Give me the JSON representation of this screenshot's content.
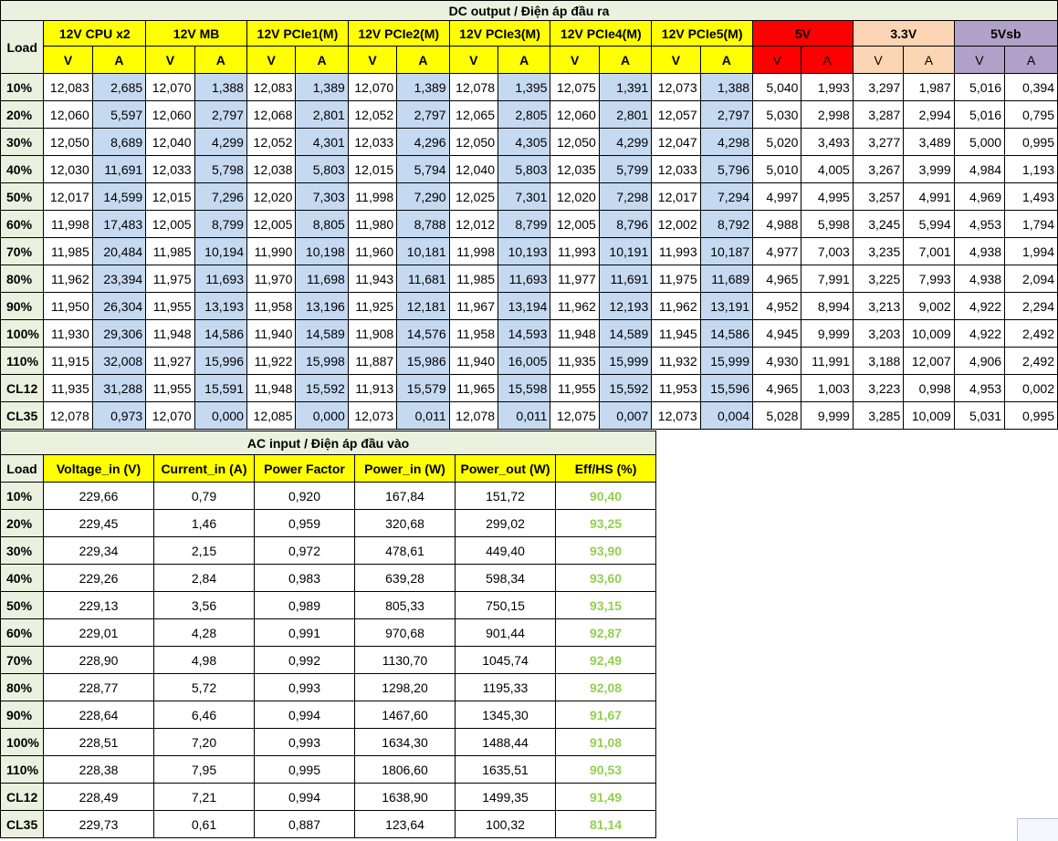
{
  "dc": {
    "caption": "DC output / Điện áp đầu ra",
    "load_header": "Load",
    "v_label": "V",
    "a_label": "A",
    "groups": [
      "12V CPU x2",
      "12V MB",
      "12V PCIe1(M)",
      "12V PCIe2(M)",
      "12V PCIe3(M)",
      "12V PCIe4(M)",
      "12V PCIe5(M)",
      "5V",
      "3.3V",
      "5Vsb"
    ],
    "group_colors": {
      "yellow": "#FFFF00",
      "red": "#FF0000",
      "peach": "#FCD5B4",
      "purple": "#B1A0C7",
      "blue_cell": "#C5D9F1",
      "green_header": "#EBF1DE"
    },
    "rows": [
      {
        "load": "10%",
        "values": [
          "12,083",
          "2,685",
          "12,070",
          "1,388",
          "12,083",
          "1,389",
          "12,070",
          "1,389",
          "12,078",
          "1,395",
          "12,075",
          "1,391",
          "12,073",
          "1,388",
          "5,040",
          "1,993",
          "3,297",
          "1,987",
          "5,016",
          "0,394"
        ]
      },
      {
        "load": "20%",
        "values": [
          "12,060",
          "5,597",
          "12,060",
          "2,797",
          "12,068",
          "2,801",
          "12,052",
          "2,797",
          "12,065",
          "2,805",
          "12,060",
          "2,801",
          "12,057",
          "2,797",
          "5,030",
          "2,998",
          "3,287",
          "2,994",
          "5,016",
          "0,795"
        ]
      },
      {
        "load": "30%",
        "values": [
          "12,050",
          "8,689",
          "12,040",
          "4,299",
          "12,052",
          "4,301",
          "12,033",
          "4,296",
          "12,050",
          "4,305",
          "12,050",
          "4,299",
          "12,047",
          "4,298",
          "5,020",
          "3,493",
          "3,277",
          "3,489",
          "5,000",
          "0,995"
        ]
      },
      {
        "load": "40%",
        "values": [
          "12,030",
          "11,691",
          "12,033",
          "5,798",
          "12,038",
          "5,803",
          "12,015",
          "5,794",
          "12,040",
          "5,803",
          "12,035",
          "5,799",
          "12,033",
          "5,796",
          "5,010",
          "4,005",
          "3,267",
          "3,999",
          "4,984",
          "1,193"
        ]
      },
      {
        "load": "50%",
        "values": [
          "12,017",
          "14,599",
          "12,015",
          "7,296",
          "12,020",
          "7,303",
          "11,998",
          "7,290",
          "12,025",
          "7,301",
          "12,020",
          "7,298",
          "12,017",
          "7,294",
          "4,997",
          "4,995",
          "3,257",
          "4,991",
          "4,969",
          "1,493"
        ]
      },
      {
        "load": "60%",
        "values": [
          "11,998",
          "17,483",
          "12,005",
          "8,799",
          "12,005",
          "8,805",
          "11,980",
          "8,788",
          "12,012",
          "8,799",
          "12,005",
          "8,796",
          "12,002",
          "8,792",
          "4,988",
          "5,998",
          "3,245",
          "5,994",
          "4,953",
          "1,794"
        ]
      },
      {
        "load": "70%",
        "values": [
          "11,985",
          "20,484",
          "11,985",
          "10,194",
          "11,990",
          "10,198",
          "11,960",
          "10,181",
          "11,998",
          "10,193",
          "11,993",
          "10,191",
          "11,993",
          "10,187",
          "4,977",
          "7,003",
          "3,235",
          "7,001",
          "4,938",
          "1,994"
        ]
      },
      {
        "load": "80%",
        "values": [
          "11,962",
          "23,394",
          "11,975",
          "11,693",
          "11,970",
          "11,698",
          "11,943",
          "11,681",
          "11,985",
          "11,693",
          "11,977",
          "11,691",
          "11,975",
          "11,689",
          "4,965",
          "7,991",
          "3,225",
          "7,993",
          "4,938",
          "2,094"
        ]
      },
      {
        "load": "90%",
        "values": [
          "11,950",
          "26,304",
          "11,955",
          "13,193",
          "11,958",
          "13,196",
          "11,925",
          "12,181",
          "11,967",
          "13,194",
          "11,962",
          "12,193",
          "11,962",
          "13,191",
          "4,952",
          "8,994",
          "3,213",
          "9,002",
          "4,922",
          "2,294"
        ]
      },
      {
        "load": "100%",
        "values": [
          "11,930",
          "29,306",
          "11,948",
          "14,586",
          "11,940",
          "14,589",
          "11,908",
          "14,576",
          "11,958",
          "14,593",
          "11,948",
          "14,589",
          "11,945",
          "14,586",
          "4,945",
          "9,999",
          "3,203",
          "10,009",
          "4,922",
          "2,492"
        ]
      },
      {
        "load": "110%",
        "values": [
          "11,915",
          "32,008",
          "11,927",
          "15,996",
          "11,922",
          "15,998",
          "11,887",
          "15,986",
          "11,940",
          "16,005",
          "11,935",
          "15,999",
          "11,932",
          "15,999",
          "4,930",
          "11,991",
          "3,188",
          "12,007",
          "4,906",
          "2,492"
        ]
      },
      {
        "load": "CL12",
        "values": [
          "11,935",
          "31,288",
          "11,955",
          "15,591",
          "11,948",
          "15,592",
          "11,913",
          "15,579",
          "11,965",
          "15,598",
          "11,955",
          "15,592",
          "11,953",
          "15,596",
          "4,965",
          "1,003",
          "3,223",
          "0,998",
          "4,953",
          "0,002"
        ]
      },
      {
        "load": "CL35",
        "values": [
          "12,078",
          "0,973",
          "12,070",
          "0,000",
          "12,085",
          "0,000",
          "12,073",
          "0,011",
          "12,078",
          "0,011",
          "12,075",
          "0,007",
          "12,073",
          "0,004",
          "5,028",
          "9,999",
          "3,285",
          "10,009",
          "5,031",
          "0,995"
        ]
      }
    ]
  },
  "ac": {
    "caption": "AC input / Điện áp đầu vào",
    "columns": [
      "Load",
      "Voltage_in (V)",
      "Current_in (A)",
      "Power Factor",
      "Power_in (W)",
      "Power_out (W)",
      "Eff/HS (%)"
    ],
    "eff_color": "#92D050",
    "rows": [
      [
        "10%",
        "229,66",
        "0,79",
        "0,920",
        "167,84",
        "151,72",
        "90,40"
      ],
      [
        "20%",
        "229,45",
        "1,46",
        "0,959",
        "320,68",
        "299,02",
        "93,25"
      ],
      [
        "30%",
        "229,34",
        "2,15",
        "0,972",
        "478,61",
        "449,40",
        "93,90"
      ],
      [
        "40%",
        "229,26",
        "2,84",
        "0,983",
        "639,28",
        "598,34",
        "93,60"
      ],
      [
        "50%",
        "229,13",
        "3,56",
        "0,989",
        "805,33",
        "750,15",
        "93,15"
      ],
      [
        "60%",
        "229,01",
        "4,28",
        "0,991",
        "970,68",
        "901,44",
        "92,87"
      ],
      [
        "70%",
        "228,90",
        "4,98",
        "0,992",
        "1130,70",
        "1045,74",
        "92,49"
      ],
      [
        "80%",
        "228,77",
        "5,72",
        "0,993",
        "1298,20",
        "1195,33",
        "92,08"
      ],
      [
        "90%",
        "228,64",
        "6,46",
        "0,994",
        "1467,60",
        "1345,30",
        "91,67"
      ],
      [
        "100%",
        "228,51",
        "7,20",
        "0,993",
        "1634,30",
        "1488,44",
        "91,08"
      ],
      [
        "110%",
        "228,38",
        "7,95",
        "0,995",
        "1806,60",
        "1635,51",
        "90,53"
      ],
      [
        "CL12",
        "228,49",
        "7,21",
        "0,994",
        "1638,90",
        "1499,35",
        "91,49"
      ],
      [
        "CL35",
        "229,73",
        "0,61",
        "0,887",
        "123,64",
        "100,32",
        "81,14"
      ]
    ]
  }
}
